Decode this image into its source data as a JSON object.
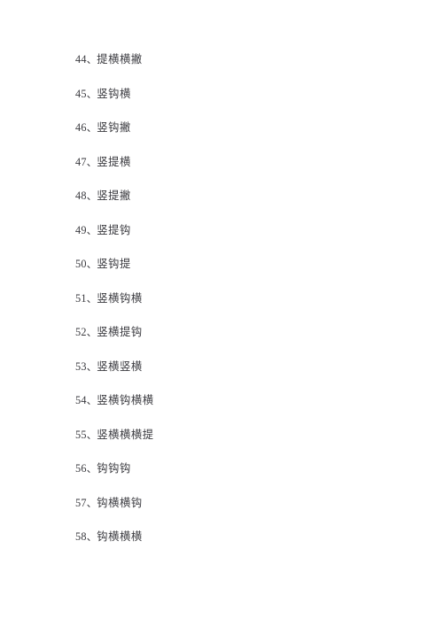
{
  "page": {
    "background_color": "#ffffff",
    "text_color": "#3a3a3f",
    "separator": "、"
  },
  "list": {
    "items": [
      {
        "number": "44",
        "text": "提横横撇"
      },
      {
        "number": "45",
        "text": "竖钩横"
      },
      {
        "number": "46",
        "text": "竖钩撇"
      },
      {
        "number": "47",
        "text": "竖提横"
      },
      {
        "number": "48",
        "text": "竖提撇"
      },
      {
        "number": "49",
        "text": "竖提钩"
      },
      {
        "number": "50",
        "text": "竖钩提"
      },
      {
        "number": "51",
        "text": "竖横钩横"
      },
      {
        "number": "52",
        "text": "竖横提钩"
      },
      {
        "number": "53",
        "text": "竖横竖横"
      },
      {
        "number": "54",
        "text": "竖横钩横横"
      },
      {
        "number": "55",
        "text": "竖横横横提"
      },
      {
        "number": "56",
        "text": "钩钩钩"
      },
      {
        "number": "57",
        "text": "钩横横钩"
      },
      {
        "number": "58",
        "text": "钩横横横"
      }
    ]
  }
}
